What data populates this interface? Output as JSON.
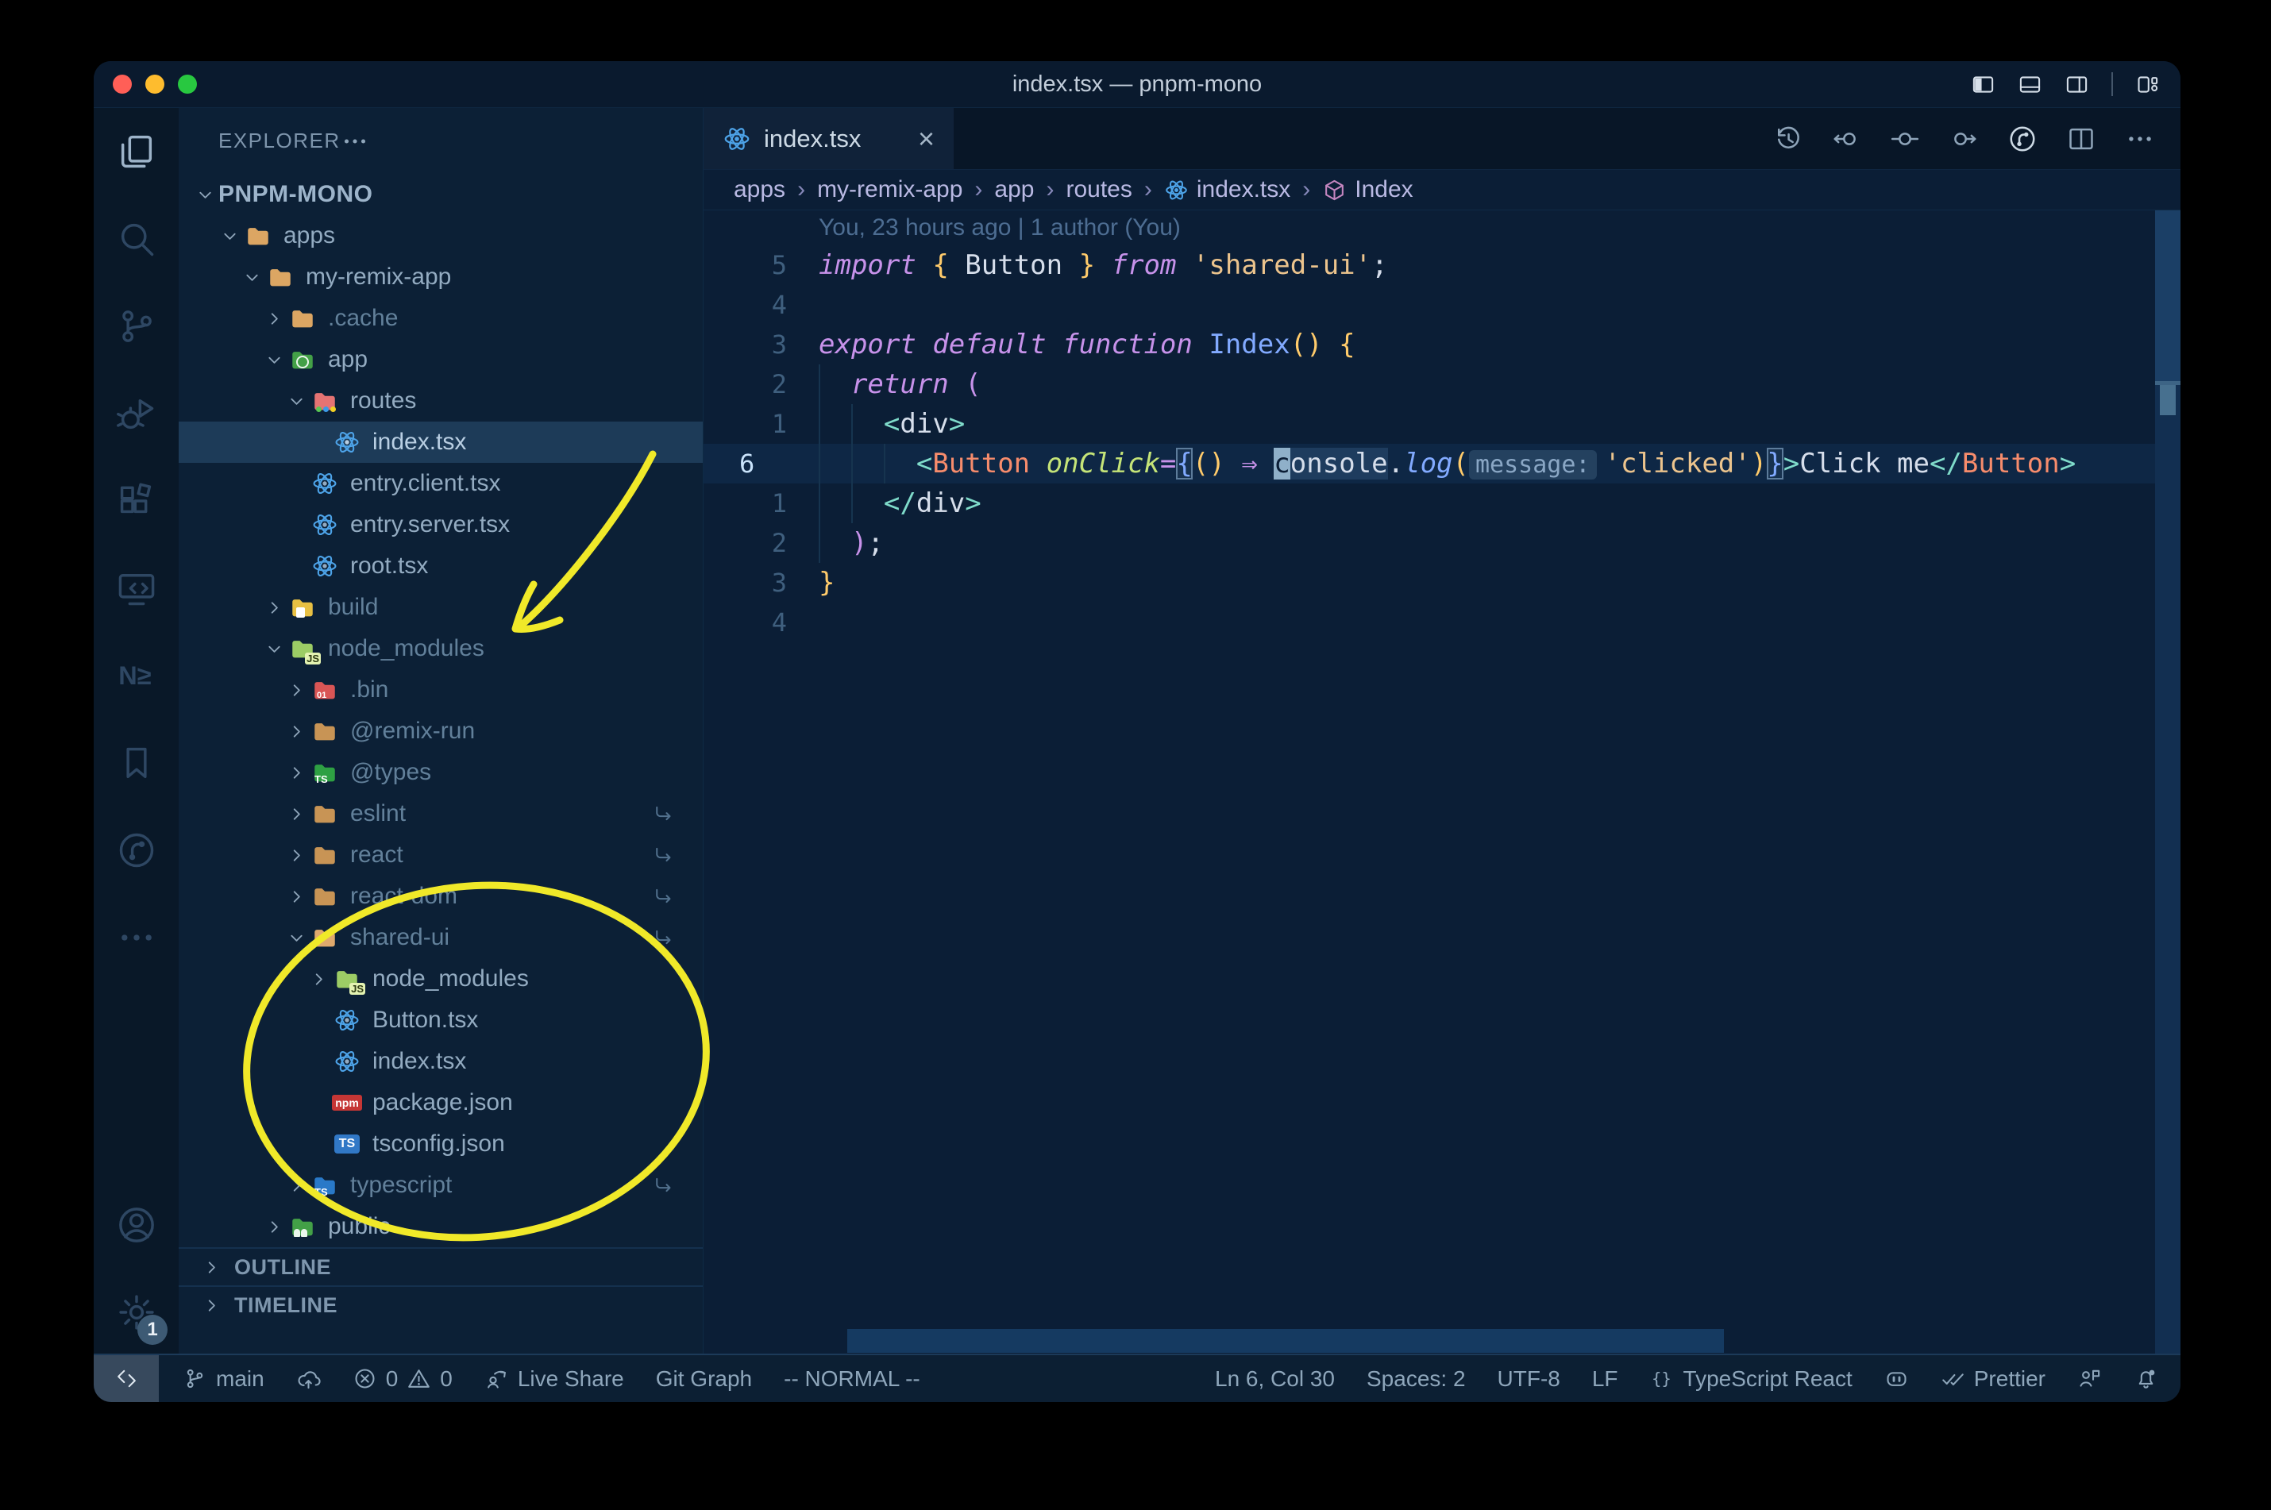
{
  "colors": {
    "window_bg": "#0b1e36",
    "titlebar_bg": "#0a1a2e",
    "sidebar_bg": "#0c2036",
    "activity_bg": "#091828",
    "statusbar_bg": "#0c1f33",
    "selection_bg": "#1d3b58",
    "annotation_yellow": "#f0e929",
    "accent_react_blue": "#4da3e8",
    "traffic_red": "#ff5f57",
    "traffic_yellow": "#febc2e",
    "traffic_green": "#28c840",
    "code_keyword": "#c792ea",
    "code_string": "#ecc48d",
    "code_function": "#82aaff",
    "code_tag": "#f78c6c",
    "code_punct_yellow": "#ffcb6b",
    "code_teal": "#7fdbca"
  },
  "window": {
    "title": "index.tsx — pnpm-mono"
  },
  "title_bar": {
    "traffic_lights": [
      {
        "name": "close",
        "color": "#ff5f57"
      },
      {
        "name": "minimize",
        "color": "#febc2e"
      },
      {
        "name": "zoom",
        "color": "#28c840"
      }
    ],
    "layout_icons": [
      "toggle-primary-sidebar",
      "toggle-panel",
      "toggle-secondary-sidebar",
      "customize-layout"
    ]
  },
  "activity_bar": {
    "top": [
      {
        "name": "explorer",
        "icon": "files",
        "active": true
      },
      {
        "name": "search",
        "icon": "search"
      },
      {
        "name": "source-control",
        "icon": "scm"
      },
      {
        "name": "run-debug",
        "icon": "debug"
      },
      {
        "name": "extensions",
        "icon": "ext"
      },
      {
        "name": "remote-explorer",
        "icon": "remote"
      },
      {
        "name": "nx-console",
        "icon": "nx"
      },
      {
        "name": "bookmarks",
        "icon": "bookmark"
      },
      {
        "name": "git-graph",
        "icon": "gitgraph"
      },
      {
        "name": "more-views",
        "icon": "more"
      }
    ],
    "bottom": [
      {
        "name": "accounts",
        "icon": "account"
      },
      {
        "name": "settings",
        "icon": "gear",
        "badge": "1"
      }
    ]
  },
  "explorer": {
    "header": "EXPLORER",
    "workspace": "PNPM-MONO",
    "tree": [
      {
        "label": "apps",
        "depth": 1,
        "chevron": "down",
        "icon": "folder",
        "color": "#dca663"
      },
      {
        "label": "my-remix-app",
        "depth": 2,
        "chevron": "down",
        "icon": "folder",
        "color": "#dca663"
      },
      {
        "label": ".cache",
        "depth": 3,
        "chevron": "right",
        "icon": "folder",
        "color": "#dca663",
        "dim": true
      },
      {
        "label": "app",
        "depth": 3,
        "chevron": "down",
        "icon": "folder-app",
        "color": "#43a047"
      },
      {
        "label": "routes",
        "depth": 4,
        "chevron": "down",
        "icon": "folder-routes",
        "color": "#e57373"
      },
      {
        "label": "index.tsx",
        "depth": 5,
        "icon": "react",
        "selected": true
      },
      {
        "label": "entry.client.tsx",
        "depth": 4,
        "icon": "react"
      },
      {
        "label": "entry.server.tsx",
        "depth": 4,
        "icon": "react"
      },
      {
        "label": "root.tsx",
        "depth": 4,
        "icon": "react"
      },
      {
        "label": "build",
        "depth": 3,
        "chevron": "right",
        "icon": "folder-build",
        "color": "#e8c043",
        "dim": true
      },
      {
        "label": "node_modules",
        "depth": 3,
        "chevron": "down",
        "icon": "folder-js",
        "color": "#9ccc65",
        "dim": true
      },
      {
        "label": ".bin",
        "depth": 4,
        "chevron": "right",
        "icon": "folder-bin",
        "color": "#d95555",
        "dim": true
      },
      {
        "label": "@remix-run",
        "depth": 4,
        "chevron": "right",
        "icon": "folder",
        "color": "#c89455",
        "dim": true
      },
      {
        "label": "@types",
        "depth": 4,
        "chevron": "right",
        "icon": "folder-ts",
        "color": "#2ea043",
        "dim": true
      },
      {
        "label": "eslint",
        "depth": 4,
        "chevron": "right",
        "icon": "folder",
        "color": "#c89455",
        "dim": true,
        "symlink": true
      },
      {
        "label": "react",
        "depth": 4,
        "chevron": "right",
        "icon": "folder",
        "color": "#c89455",
        "dim": true,
        "symlink": true
      },
      {
        "label": "react-dom",
        "depth": 4,
        "chevron": "right",
        "icon": "folder",
        "color": "#c89455",
        "dim": true,
        "symlink": true
      },
      {
        "label": "shared-ui",
        "depth": 4,
        "chevron": "down",
        "icon": "folder",
        "color": "#e0a96d",
        "dim": true,
        "symlink": true
      },
      {
        "label": "node_modules",
        "depth": 5,
        "chevron": "right",
        "icon": "folder-js",
        "color": "#9ccc65"
      },
      {
        "label": "Button.tsx",
        "depth": 5,
        "icon": "react"
      },
      {
        "label": "index.tsx",
        "depth": 5,
        "icon": "react"
      },
      {
        "label": "package.json",
        "depth": 5,
        "icon": "npm"
      },
      {
        "label": "tsconfig.json",
        "depth": 5,
        "icon": "ts-config"
      },
      {
        "label": "typescript",
        "depth": 4,
        "chevron": "right",
        "icon": "folder-ts-blue",
        "color": "#2979c8",
        "dim": true,
        "symlink": true
      },
      {
        "label": "public",
        "depth": 3,
        "chevron": "right",
        "icon": "folder-public",
        "color": "#43a047"
      }
    ],
    "sections": [
      "OUTLINE",
      "TIMELINE"
    ]
  },
  "tab": {
    "label": "index.tsx",
    "icon": "react",
    "close": "×"
  },
  "editor_actions": [
    {
      "name": "timeline-history",
      "icon": "history"
    },
    {
      "name": "nav-back",
      "icon": "navback"
    },
    {
      "name": "nav-location",
      "icon": "navloc"
    },
    {
      "name": "nav-forward",
      "icon": "navfwd"
    },
    {
      "name": "git-graph",
      "icon": "gitgraph",
      "bright": true
    },
    {
      "name": "split-editor",
      "icon": "split"
    },
    {
      "name": "more-actions",
      "icon": "more"
    }
  ],
  "breadcrumbs": [
    {
      "label": "apps"
    },
    {
      "label": "my-remix-app"
    },
    {
      "label": "app"
    },
    {
      "label": "routes"
    },
    {
      "label": "index.tsx",
      "icon": "react"
    },
    {
      "label": "Index",
      "icon": "cube"
    }
  ],
  "editor": {
    "blame": "You, 23 hours ago | 1 author (You)",
    "lines": [
      {
        "gutter": "5",
        "segs": [
          {
            "t": "import",
            "c": "kw"
          },
          {
            "t": " "
          },
          {
            "t": "{",
            "c": "y"
          },
          {
            "t": " "
          },
          {
            "t": "Button",
            "c": "w"
          },
          {
            "t": " "
          },
          {
            "t": "}",
            "c": "y"
          },
          {
            "t": " "
          },
          {
            "t": "from",
            "c": "kw"
          },
          {
            "t": " "
          },
          {
            "t": "'shared-ui'",
            "c": "str"
          },
          {
            "t": ";",
            "c": "w"
          }
        ]
      },
      {
        "gutter": "4",
        "segs": []
      },
      {
        "gutter": "3",
        "segs": [
          {
            "t": "export",
            "c": "kw"
          },
          {
            "t": " "
          },
          {
            "t": "default",
            "c": "kw"
          },
          {
            "t": " "
          },
          {
            "t": "function",
            "c": "kw"
          },
          {
            "t": " "
          },
          {
            "t": "Index",
            "c": "fn"
          },
          {
            "t": "()",
            "c": "y"
          },
          {
            "t": " "
          },
          {
            "t": "{",
            "c": "y"
          }
        ]
      },
      {
        "gutter": "2",
        "segs": [
          {
            "t": "  "
          },
          {
            "t": "return",
            "c": "kw"
          },
          {
            "t": " "
          },
          {
            "t": "(",
            "c": "pink"
          }
        ]
      },
      {
        "gutter": "1",
        "segs": [
          {
            "t": "    "
          },
          {
            "t": "<",
            "c": "teal"
          },
          {
            "t": "div",
            "c": "w"
          },
          {
            "t": ">",
            "c": "teal"
          }
        ]
      },
      {
        "gutter": "6",
        "current": true,
        "segs": [
          {
            "t": "      "
          },
          {
            "t": "<",
            "c": "teal"
          },
          {
            "t": "Button",
            "c": "tag"
          },
          {
            "t": " "
          },
          {
            "t": "onClick",
            "c": "attr"
          },
          {
            "t": "=",
            "c": "pink"
          },
          {
            "t": "{",
            "c": "brk"
          },
          {
            "t": "()",
            "c": "y"
          },
          {
            "t": " "
          },
          {
            "t": "⇒",
            "c": "pink"
          },
          {
            "t": " "
          },
          {
            "t": "c",
            "c": "cursor"
          },
          {
            "t": "onsole",
            "c": "w hl"
          },
          {
            "t": ".",
            "c": "w"
          },
          {
            "t": "log",
            "c": "fn i"
          },
          {
            "t": "(",
            "c": "y"
          },
          {
            "t": "message:",
            "c": "inlay"
          },
          {
            "t": "'clicked'",
            "c": "str"
          },
          {
            "t": ")",
            "c": "y"
          },
          {
            "t": "}",
            "c": "brk"
          },
          {
            "t": ">",
            "c": "teal"
          },
          {
            "t": "Click me",
            "c": "w"
          },
          {
            "t": "</",
            "c": "teal"
          },
          {
            "t": "Button",
            "c": "tag"
          },
          {
            "t": ">",
            "c": "teal"
          }
        ]
      },
      {
        "gutter": "1",
        "segs": [
          {
            "t": "    "
          },
          {
            "t": "</",
            "c": "teal"
          },
          {
            "t": "div",
            "c": "w"
          },
          {
            "t": ">",
            "c": "teal"
          }
        ]
      },
      {
        "gutter": "2",
        "segs": [
          {
            "t": "  "
          },
          {
            "t": ")",
            "c": "pink"
          },
          {
            "t": ";",
            "c": "w"
          }
        ]
      },
      {
        "gutter": "3",
        "segs": [
          {
            "t": "}",
            "c": "y"
          }
        ]
      },
      {
        "gutter": "4",
        "segs": []
      }
    ]
  },
  "status_bar": {
    "left": [
      {
        "name": "remote-indicator",
        "icon": "remoteind",
        "special": true
      },
      {
        "name": "git-branch",
        "icon": "branch",
        "label": "main"
      },
      {
        "name": "publish",
        "icon": "cloudup"
      },
      {
        "name": "problems",
        "parts": [
          {
            "icon": "errcirc",
            "label": "0"
          },
          {
            "icon": "warntri",
            "label": "0"
          }
        ]
      },
      {
        "name": "live-share",
        "icon": "liveshare",
        "label": "Live Share"
      },
      {
        "name": "git-graph",
        "label": "Git Graph"
      },
      {
        "name": "vim-mode",
        "label": "-- NORMAL --"
      }
    ],
    "right": [
      {
        "name": "cursor-position",
        "label": "Ln 6, Col 30"
      },
      {
        "name": "indentation",
        "label": "Spaces: 2"
      },
      {
        "name": "encoding",
        "label": "UTF-8"
      },
      {
        "name": "eol",
        "label": "LF"
      },
      {
        "name": "language-mode",
        "icon": "braces",
        "label": "TypeScript React"
      },
      {
        "name": "copilot",
        "icon": "copilot"
      },
      {
        "name": "prettier",
        "icon": "dblcheck",
        "label": "Prettier"
      },
      {
        "name": "feedback",
        "icon": "feedback"
      },
      {
        "name": "notifications",
        "icon": "belldot"
      }
    ]
  },
  "annotations": {
    "color": "#f0e929",
    "shapes": [
      "hand-drawn-arrow",
      "hand-drawn-ellipse"
    ]
  }
}
